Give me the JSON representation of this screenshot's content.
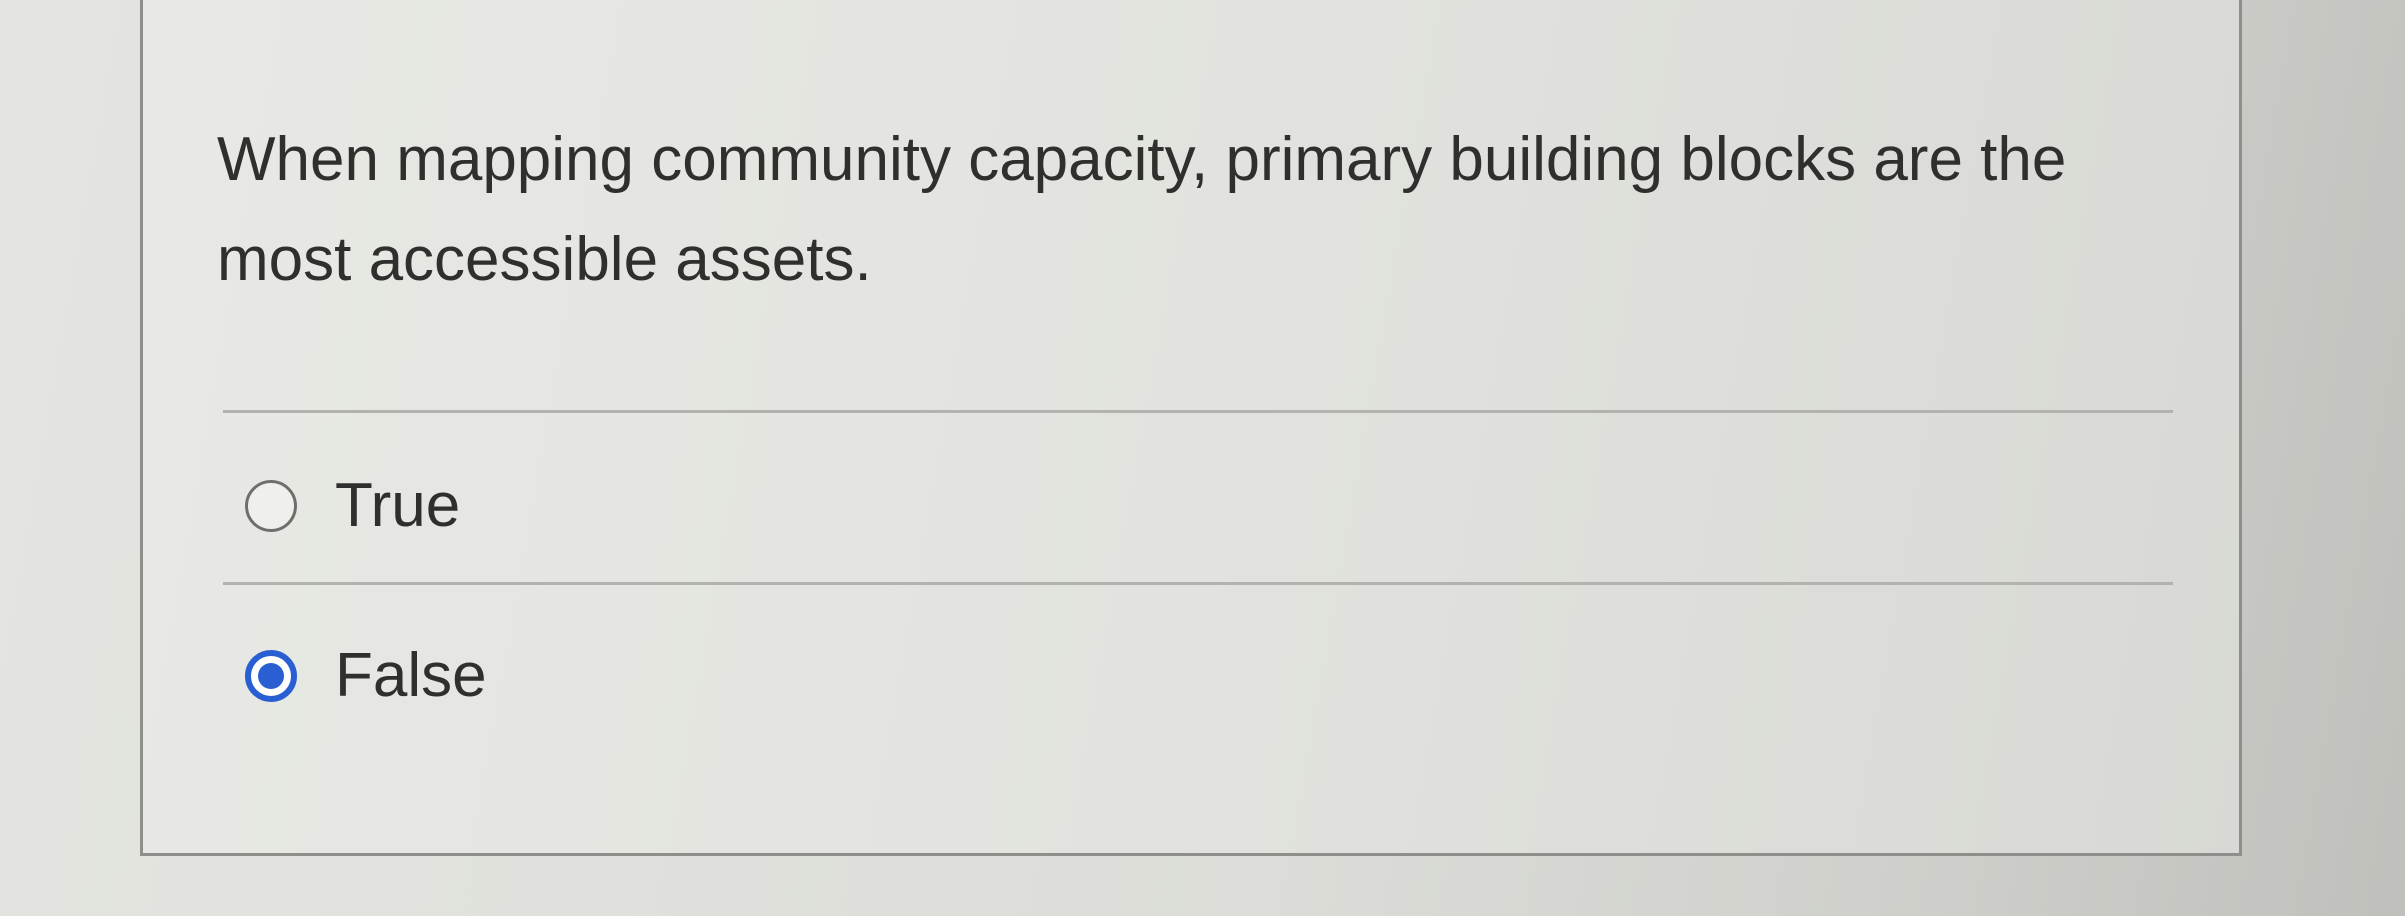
{
  "question": {
    "text": "When mapping community capacity, primary building blocks are the most accessible assets."
  },
  "options": [
    {
      "label": "True",
      "selected": false
    },
    {
      "label": "False",
      "selected": true
    }
  ],
  "colors": {
    "radio_selected": "#2a5fd3",
    "text": "#2f302e",
    "divider": "#b2b3af"
  }
}
